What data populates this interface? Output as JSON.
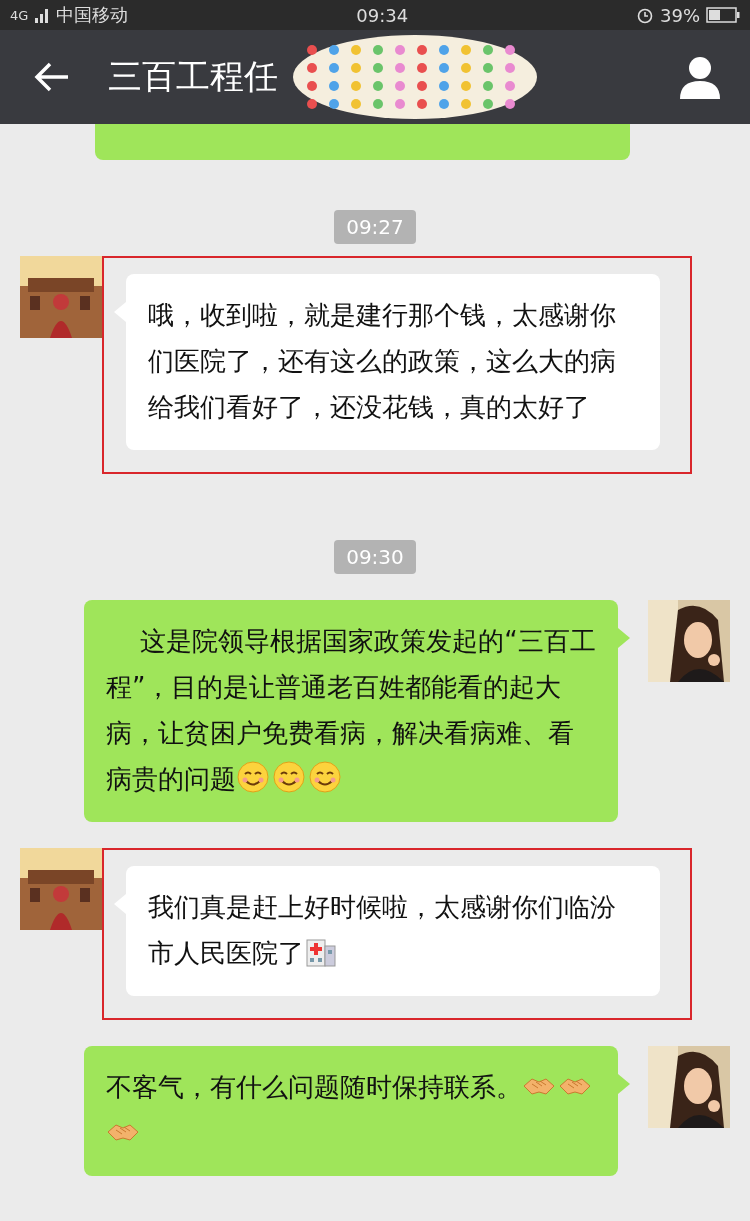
{
  "status_bar": {
    "network": "4G",
    "carrier": "中国移动",
    "time": "09:34",
    "battery": "39%"
  },
  "header": {
    "title": "三百工程任",
    "obscured": true
  },
  "messages": [
    {
      "kind": "clipped",
      "outgoing": true
    },
    {
      "kind": "time",
      "text": "09:27"
    },
    {
      "kind": "text",
      "outgoing": false,
      "highlighted": true,
      "text": "哦，收到啦，就是建行那个钱，太感谢你们医院了，还有这么的政策，这么大的病给我们看好了，还没花钱，真的太好了"
    },
    {
      "kind": "time",
      "text": "09:30"
    },
    {
      "kind": "text",
      "outgoing": true,
      "highlighted": false,
      "text": "　 这是院领导根据国家政策发起的“三百工程”，目的是让普通老百姓都能看的起大病，让贫困户免费看病，解决看病难、看病贵的问题",
      "emojis": [
        {
          "kind": "smile"
        },
        {
          "kind": "smile"
        },
        {
          "kind": "smile"
        }
      ]
    },
    {
      "kind": "text",
      "outgoing": false,
      "highlighted": true,
      "text": "我们真是赶上好时候啦，太感谢你们临汾市人民医院了",
      "emojis": [
        {
          "kind": "hospital"
        }
      ]
    },
    {
      "kind": "text",
      "outgoing": true,
      "highlighted": false,
      "text": "不客气，有什么问题随时保持联系。",
      "emojis": [
        {
          "kind": "handshake"
        },
        {
          "kind": "handshake"
        },
        {
          "kind": "handshake"
        }
      ]
    }
  ]
}
